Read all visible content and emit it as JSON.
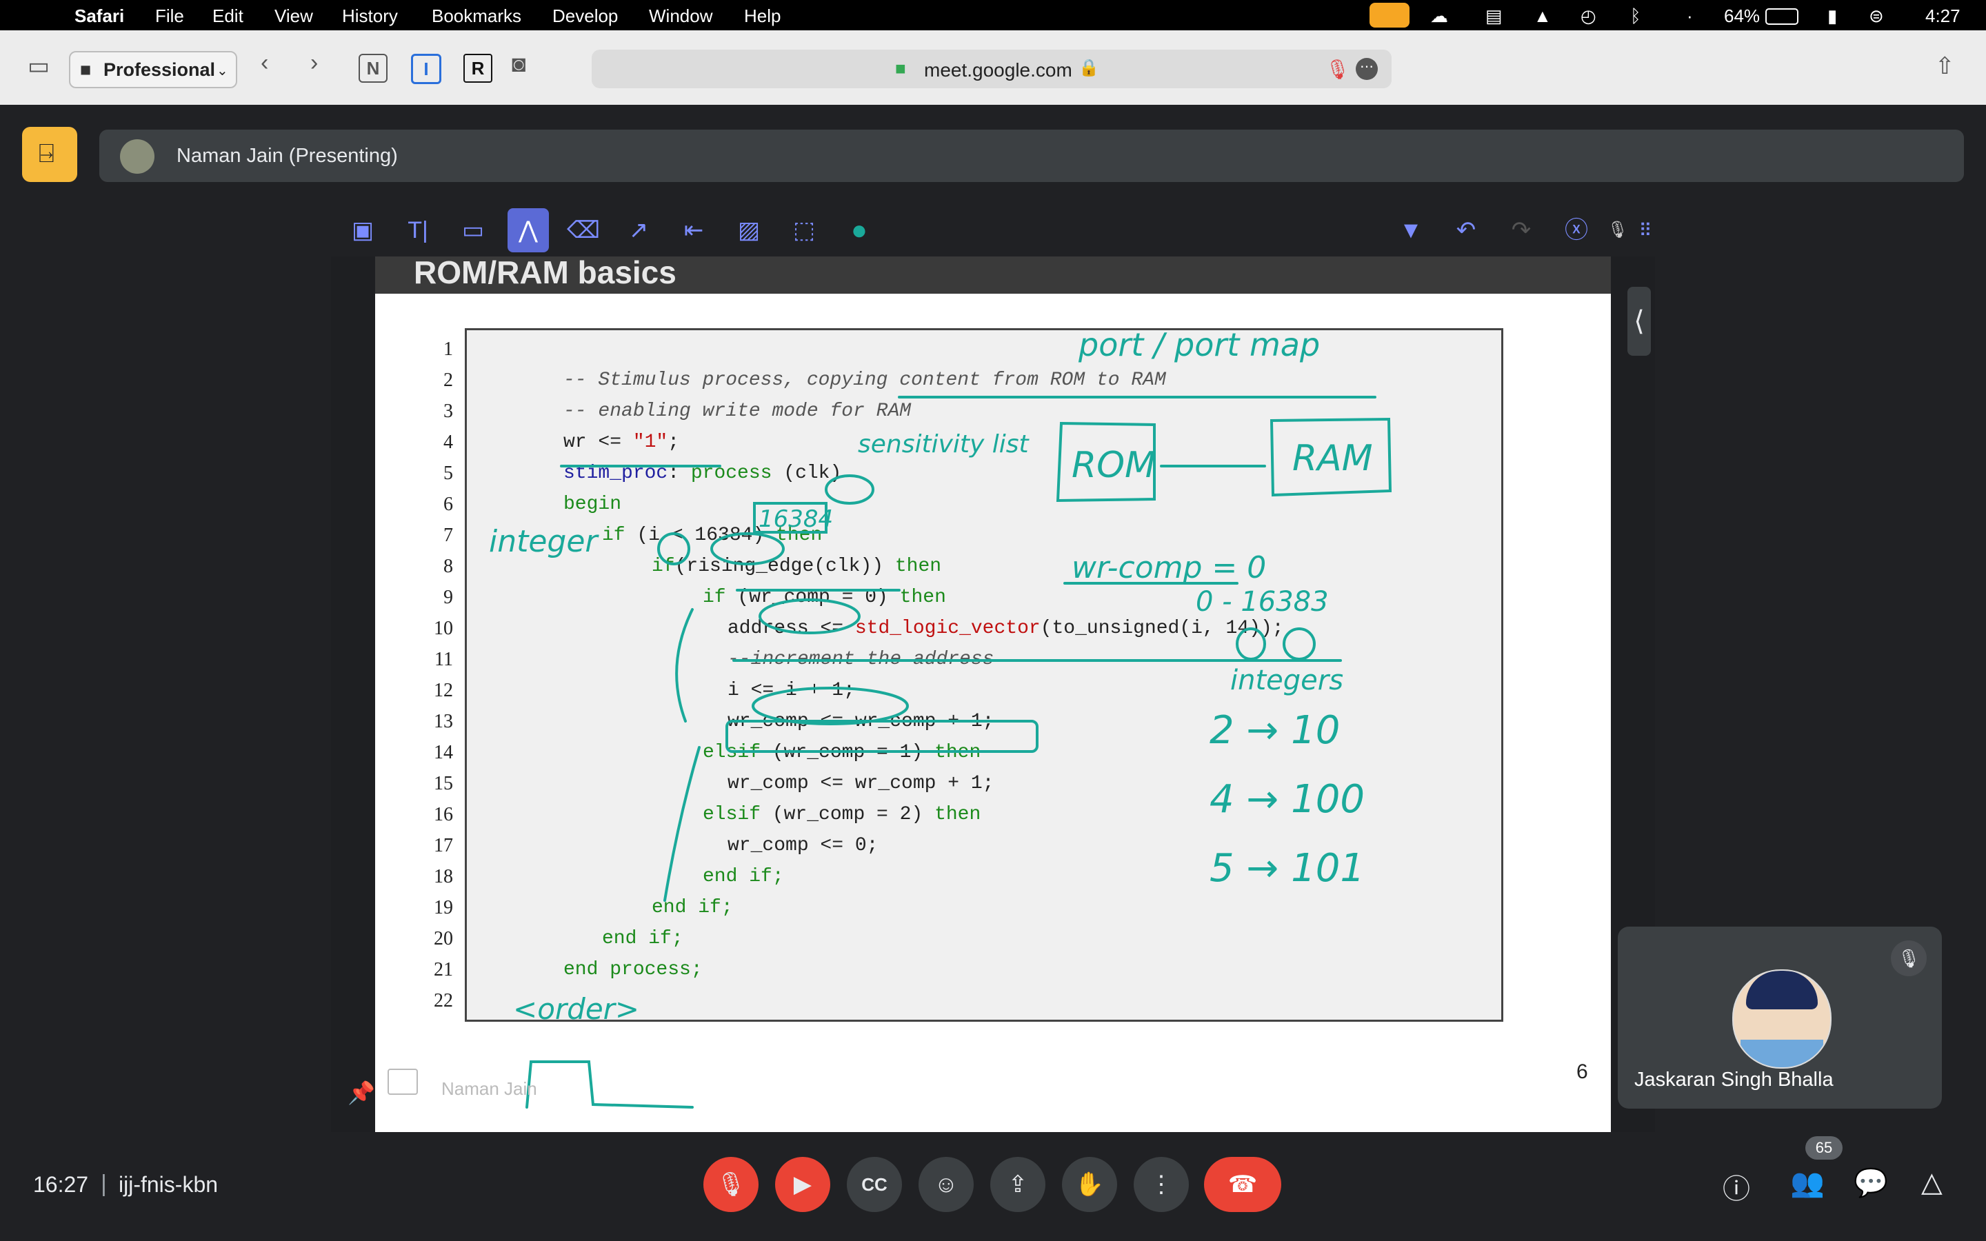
{
  "menubar": {
    "apple": "",
    "app": "Safari",
    "items": [
      "File",
      "Edit",
      "View",
      "History",
      "Bookmarks",
      "Develop",
      "Window",
      "Help"
    ],
    "battery": "64%",
    "time": "4:27"
  },
  "safari": {
    "profile": "Professional",
    "url": "meet.google.com"
  },
  "meet": {
    "presenter": "Naman Jain (Presenting)",
    "slide": {
      "title_fragment": "ROM/RAM basics",
      "page_number": "6",
      "footer_name": "Naman Jain",
      "line_numbers": [
        "1",
        "2",
        "3",
        "4",
        "5",
        "6",
        "7",
        "8",
        "9",
        "10",
        "11",
        "12",
        "13",
        "14",
        "15",
        "16",
        "17",
        "18",
        "19",
        "20",
        "21",
        "22"
      ],
      "code": {
        "l2": "-- Stimulus process, copying content from ROM to RAM",
        "l3": "-- enabling write mode for RAM",
        "l4a": "wr <= ",
        "l4b": "\"1\"",
        "l4c": ";",
        "l5a": "stim_proc",
        "l5b": ": ",
        "l5c": "process",
        "l5d": " (clk)",
        "l6": "begin",
        "l7a": "if",
        "l7b": " (i < 16384) ",
        "l7c": "then",
        "l8a": "if",
        "l8b": "(rising_edge(clk)) ",
        "l8c": "then",
        "l9a": "if",
        "l9b": " (wr_comp = 0) ",
        "l9c": "then",
        "l10a": "address <= ",
        "l10b": "std_logic_vector",
        "l10c": "(to_unsigned(i, 14));",
        "l11": "--increment the address",
        "l12": "i <= i + 1;",
        "l13": "wr_comp <= wr_comp + 1;",
        "l14a": "elsif",
        "l14b": " (wr_comp = 1) ",
        "l14c": "then",
        "l15": "wr_comp <= wr_comp + 1;",
        "l16a": "elsif",
        "l16b": " (wr_comp = 2) ",
        "l16c": "then",
        "l17": "wr_comp <= 0;",
        "l18": "end if;",
        "l19": "end if;",
        "l20": "end if;",
        "l21": "end process;"
      },
      "handwriting": {
        "port": "port / port map",
        "sensitivity": "sensitivity list",
        "rom": "ROM",
        "ram": "RAM",
        "n16384": "16384",
        "integer_left": "integer",
        "wrcomp": "wr-comp = 0",
        "range": "0 - 16383",
        "integers": "integers",
        "b1": "2 → 10",
        "b2": "4 → 100",
        "b3": "5 → 101",
        "order": "<order>"
      }
    },
    "participant": "Jaskaran Singh Bhalla",
    "meeting_time": "16:27",
    "meeting_code": "ijj-fnis-kbn",
    "people_count": "65"
  },
  "colors": {
    "annotation": "#1aa99a",
    "accent_yellow": "#f6b93b",
    "red": "#ea4335"
  }
}
